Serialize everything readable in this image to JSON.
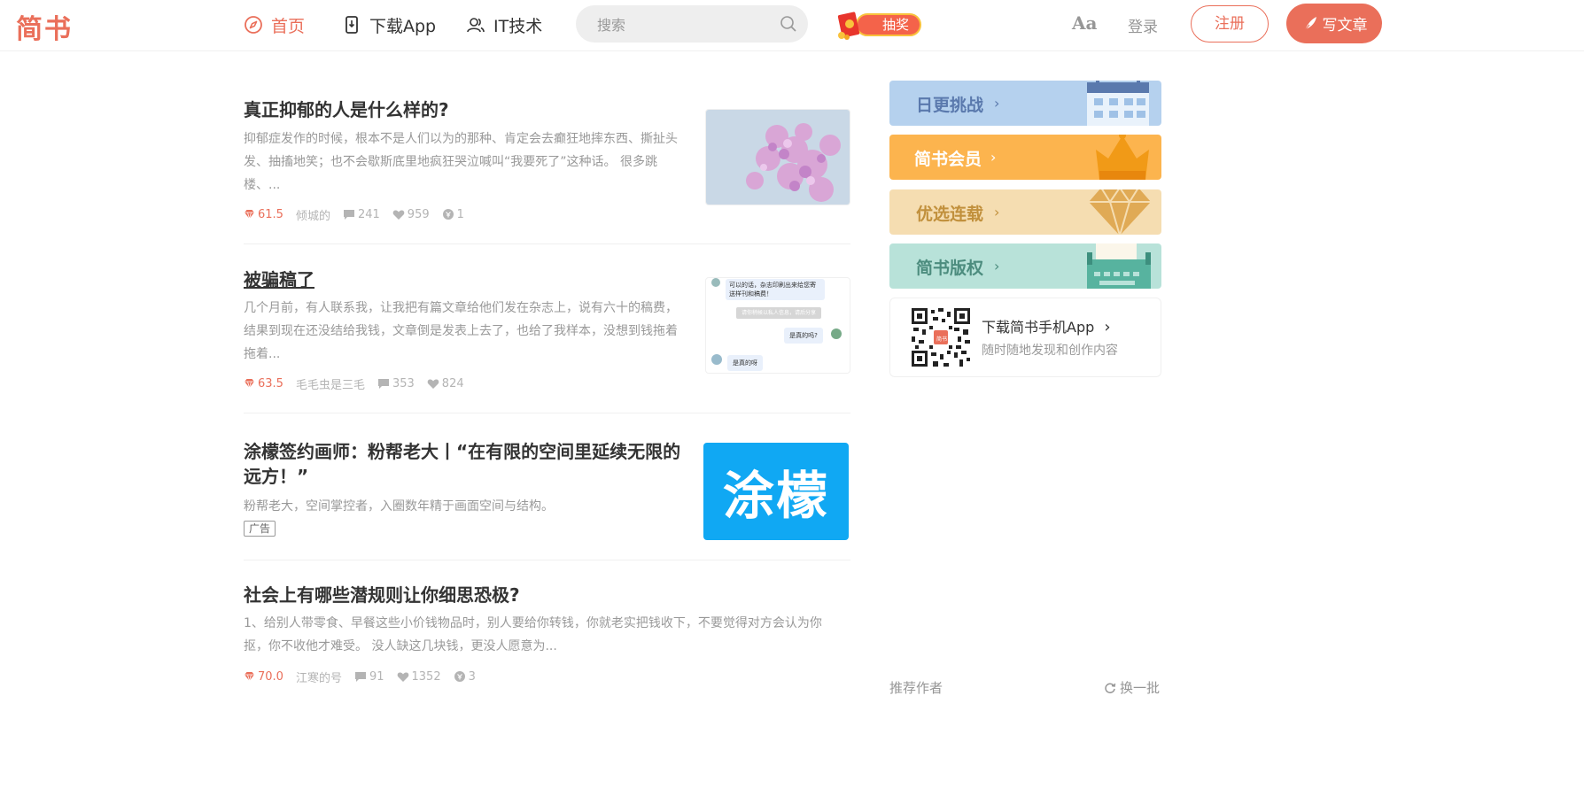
{
  "header": {
    "logo": "简书",
    "nav": [
      {
        "label": "首页",
        "icon": "compass-icon",
        "active": true
      },
      {
        "label": "下载App",
        "icon": "phone-icon",
        "active": false
      },
      {
        "label": "IT技术",
        "icon": "people-icon",
        "active": false
      }
    ],
    "search_placeholder": "搜索",
    "lottery_label": "抽奖",
    "font_toggle": "Aa",
    "login": "登录",
    "signup": "注册",
    "write": "写文章",
    "accent_color": "#ea6f5a"
  },
  "articles": [
    {
      "title": "真正抑郁的人是什么样的?",
      "abstract": [
        "抑郁症发作的时候，根本不是人们以为的那种、肯定会去癫狂地摔东西、撕扯头",
        "发、抽搐地笑；也不会歇斯底里地疯狂哭泣喊叫“我要死了”这种话。 很多跳",
        "楼、..."
      ],
      "diamond": "61.5",
      "author": "倾城的",
      "comments": "241",
      "likes": "959",
      "rewards": "1"
    },
    {
      "title": "被骗稿了",
      "abstract": [
        "几个月前，有人联系我，让我把有篇文章给他们发在杂志上，说有六十的稿费，",
        "结果到现在还没结给我钱，文章倒是发表上去了，也给了我样本，没想到钱拖着",
        "拖着..."
      ],
      "diamond": "63.5",
      "author": "毛毛虫是三毛",
      "comments": "353",
      "likes": "824",
      "chat": {
        "bubble1": "可以的话，杂志印刷出来给您寄送样刊和稿费！",
        "notice": "请你稍候以私人信息，请后分享",
        "reply": "是真的吗?",
        "bubble2": "是真的呀"
      }
    },
    {
      "title": [
        "涂檬签约画师：粉帮老大丨“在有限的空间里延续无限的",
        "远方！”"
      ],
      "abstract": [
        "粉帮老大，空间掌控者，入圈数年精于画面空间与结构。"
      ],
      "ad_tag": "广告",
      "image_text": "涂檬"
    },
    {
      "title": "社会上有哪些潜规则让你细思恐极?",
      "abstract": [
        "1、给别人带零食、早餐这些小价钱物品时，别人要给你转钱，你就老实把钱收下，不要觉得对方会认为你",
        "抠，你不收他才难受。 没人缺这几块钱，更没人愿意为..."
      ],
      "diamond": "70.0",
      "author": "江寒的号",
      "comments": "91",
      "likes": "1352",
      "rewards": "3"
    }
  ],
  "sidebar": {
    "banners": [
      {
        "label": "日更挑战",
        "color": "#b5d1ee",
        "text_color": "#5a79ad",
        "icon": "calendar-icon"
      },
      {
        "label": "简书会员",
        "color": "#fcb44e",
        "text_color": "#ffffff",
        "icon": "crown-icon"
      },
      {
        "label": "优选连载",
        "color": "#f5ddb1",
        "text_color": "#c1903c",
        "icon": "diamond-icon"
      },
      {
        "label": "简书版权",
        "color": "#b8e2d9",
        "text_color": "#4c8c7e",
        "icon": "typewriter-icon"
      }
    ],
    "app": {
      "title": "下载简书手机App",
      "subtitle": "随时随地发现和创作内容",
      "qr_badge": "简书"
    },
    "recommend_title": "推荐作者",
    "refresh_label": "换一批"
  }
}
